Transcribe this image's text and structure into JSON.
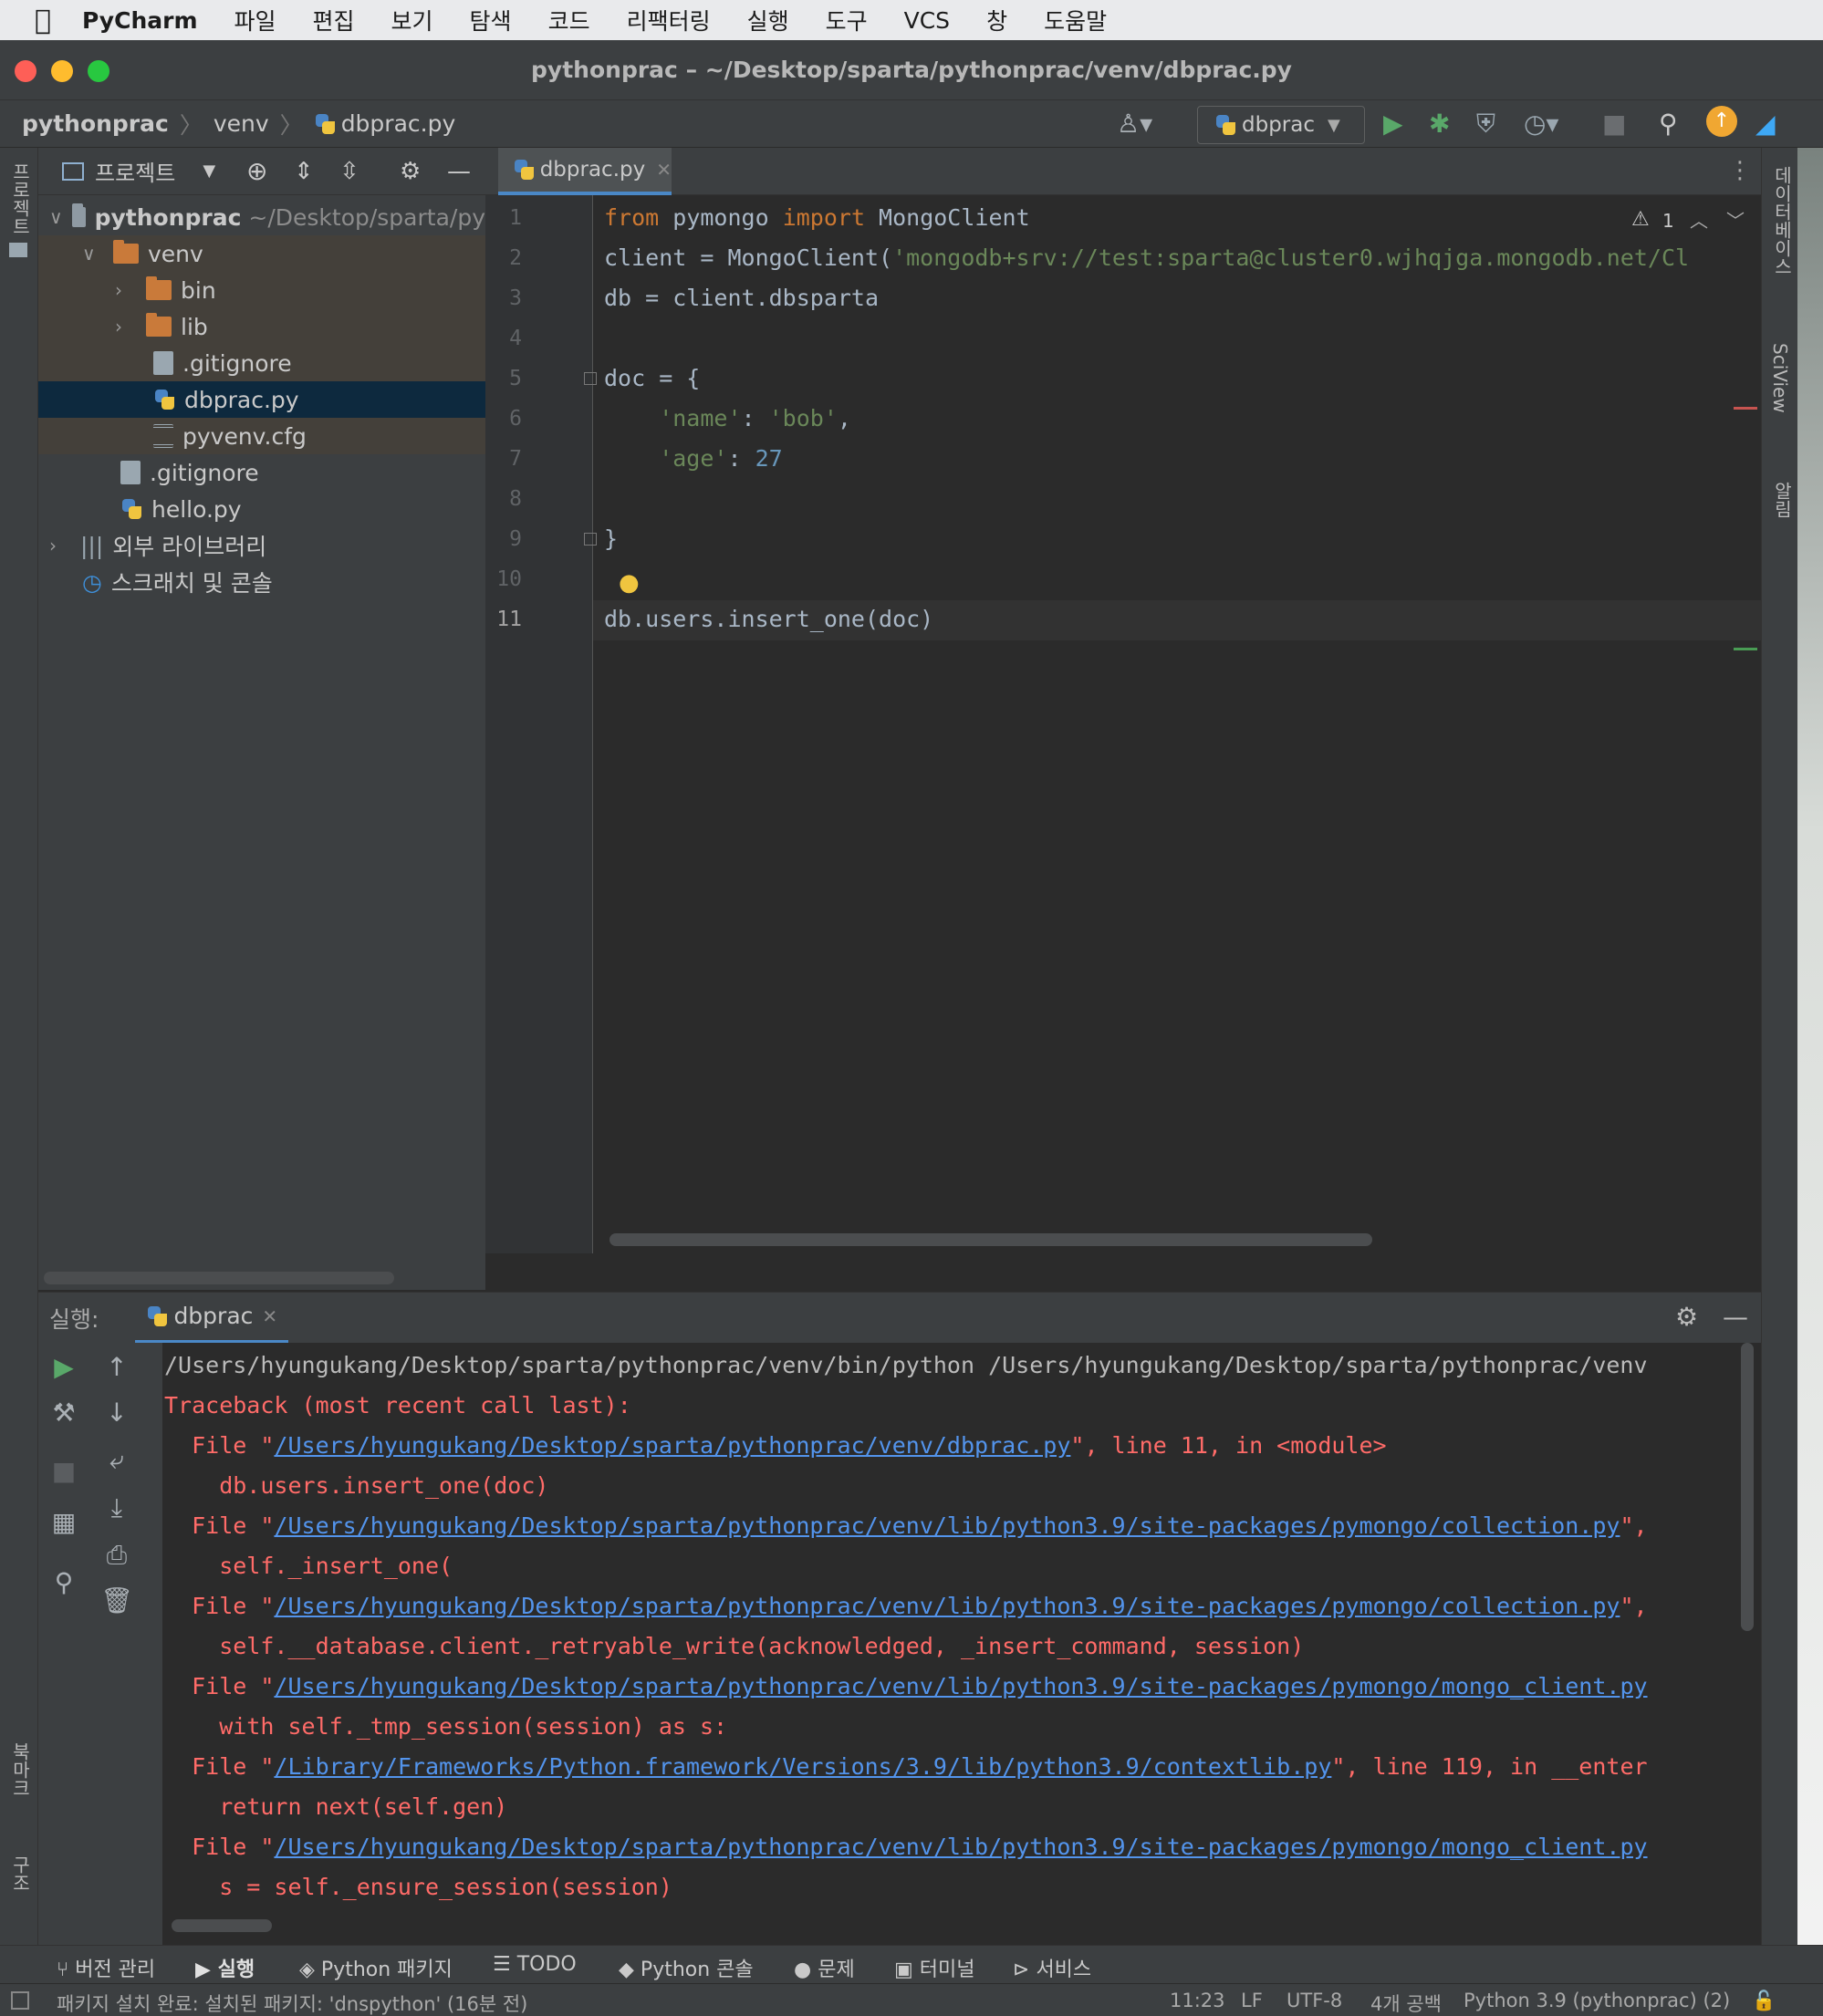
{
  "menubar": {
    "app": "PyCharm",
    "items": [
      "파일",
      "편집",
      "보기",
      "탐색",
      "코드",
      "리팩터링",
      "실행",
      "도구",
      "VCS",
      "창",
      "도움말"
    ]
  },
  "window": {
    "title": "pythonprac – ~/Desktop/sparta/pythonprac/venv/dbprac.py"
  },
  "breadcrumb": [
    "pythonprac",
    "venv",
    "dbprac.py"
  ],
  "run_config": {
    "selected": "dbprac"
  },
  "left_stripe": {
    "project": "프로젝트",
    "bookmarks": "북마크",
    "structure": "구조"
  },
  "right_stripe": {
    "database": "데이터베이스",
    "sciview": "SciView",
    "notifications": "알림"
  },
  "project_panel": {
    "title": "프로젝트",
    "tree": [
      {
        "label": "pythonprac",
        "hint": "~/Desktop/sparta/py",
        "type": "root"
      },
      {
        "label": "venv",
        "type": "folder"
      },
      {
        "label": "bin",
        "type": "folder"
      },
      {
        "label": "lib",
        "type": "folder"
      },
      {
        "label": ".gitignore",
        "type": "file"
      },
      {
        "label": "dbprac.py",
        "type": "python",
        "selected": true
      },
      {
        "label": "pyvenv.cfg",
        "type": "file"
      },
      {
        "label": ".gitignore",
        "type": "file"
      },
      {
        "label": "hello.py",
        "type": "python"
      },
      {
        "label": "외부 라이브러리",
        "type": "library"
      },
      {
        "label": "스크래치 및 콘솔",
        "type": "scratch"
      }
    ]
  },
  "editor": {
    "tab": "dbprac.py",
    "warnings": "1",
    "line_numbers": [
      "1",
      "2",
      "3",
      "4",
      "5",
      "6",
      "7",
      "8",
      "9",
      "10",
      "11"
    ],
    "code": {
      "l1_kw1": "from",
      "l1_mod": " pymongo ",
      "l1_kw2": "import",
      "l1_rest": " MongoClient",
      "l2_a": "client = MongoClient(",
      "l2_str": "'mongodb+srv://test:sparta@cluster0.wjhqjga.mongodb.net/Cl",
      "l3": "db = client.dbsparta",
      "l5": "doc = {",
      "l6_key": "    'name'",
      "l6_colon": ": ",
      "l6_val": "'bob'",
      "l6_end": ",",
      "l7_key": "    'age'",
      "l7_colon": ": ",
      "l7_val": "27",
      "l9": "}",
      "l11": "db.users.insert_one(doc)"
    }
  },
  "run_panel": {
    "label": "실행:",
    "tab": "dbprac",
    "lines": [
      {
        "pre": "/Users/hyungukang/Desktop/sparta/pythonprac/venv/bin/python /Users/hyungukang/Desktop/sparta/pythonprac/venv",
        "plain": true
      },
      {
        "pre": "Traceback (most recent call last):"
      },
      {
        "pre": "  File \"",
        "link": "/Users/hyungukang/Desktop/sparta/pythonprac/venv/dbprac.py",
        "post": "\", line 11, in <module>"
      },
      {
        "pre": "    db.users.insert_one(doc)"
      },
      {
        "pre": "  File \"",
        "link": "/Users/hyungukang/Desktop/sparta/pythonprac/venv/lib/python3.9/site-packages/pymongo/collection.py",
        "post": "\","
      },
      {
        "pre": "    self._insert_one("
      },
      {
        "pre": "  File \"",
        "link": "/Users/hyungukang/Desktop/sparta/pythonprac/venv/lib/python3.9/site-packages/pymongo/collection.py",
        "post": "\","
      },
      {
        "pre": "    self.__database.client._retryable_write(acknowledged, _insert_command, session)"
      },
      {
        "pre": "  File \"",
        "link": "/Users/hyungukang/Desktop/sparta/pythonprac/venv/lib/python3.9/site-packages/pymongo/mongo_client.py",
        "post": ""
      },
      {
        "pre": "    with self._tmp_session(session) as s:"
      },
      {
        "pre": "  File \"",
        "link": "/Library/Frameworks/Python.framework/Versions/3.9/lib/python3.9/contextlib.py",
        "post": "\", line 119, in __enter"
      },
      {
        "pre": "    return next(self.gen)"
      },
      {
        "pre": "  File \"",
        "link": "/Users/hyungukang/Desktop/sparta/pythonprac/venv/lib/python3.9/site-packages/pymongo/mongo_client.py",
        "post": ""
      },
      {
        "pre": "    s = self._ensure_session(session)"
      }
    ]
  },
  "tool_tabs": [
    "버전 관리",
    "실행",
    "Python 패키지",
    "TODO",
    "Python 콘솔",
    "문제",
    "터미널",
    "서비스"
  ],
  "status_bar": {
    "message": "패키지 설치 완료: 설치된 패키지: 'dnspython' (16분 전)",
    "position": "11:23",
    "line_sep": "LF",
    "encoding": "UTF-8",
    "indent": "4개 공백",
    "interpreter": "Python 3.9 (pythonprac) (2)"
  }
}
